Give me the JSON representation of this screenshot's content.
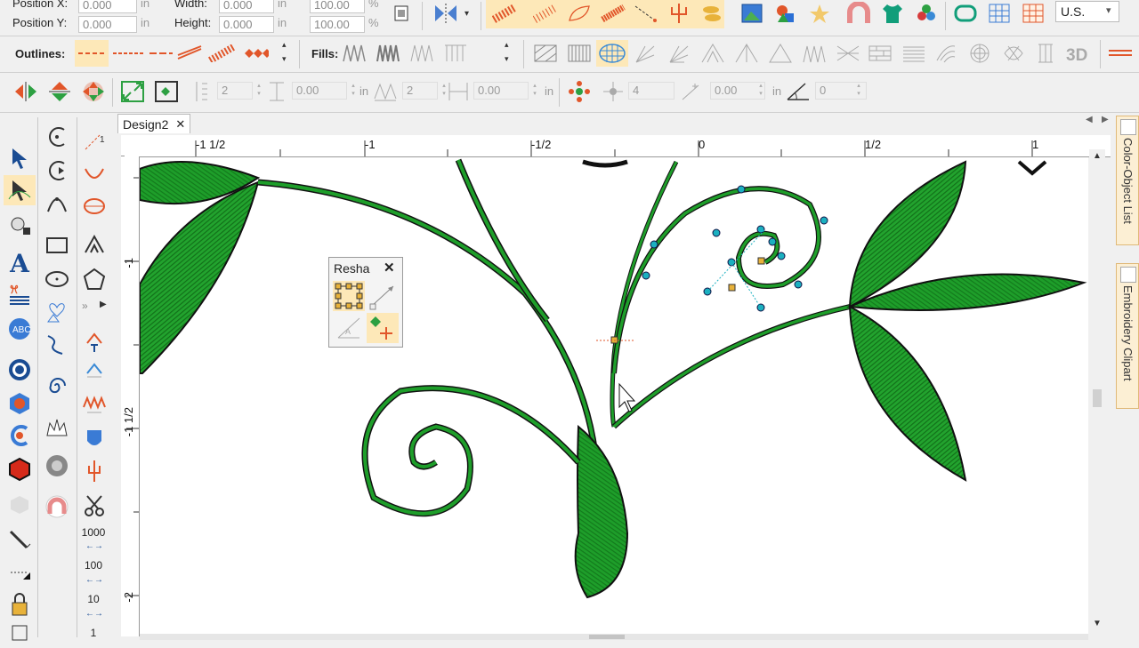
{
  "window": {
    "tab_title": "Design2",
    "tab_close": "✕"
  },
  "position": {
    "x_label": "Position X:",
    "x_value": "0.000",
    "x_unit": "in",
    "y_label": "Position Y:",
    "y_value": "0.000",
    "y_unit": "in",
    "width_label": "Width:",
    "width_value": "0.000",
    "width_unit": "in",
    "height_label": "Height:",
    "height_value": "0.000",
    "height_unit": "in",
    "scale_w": "100.00",
    "scale_h": "100.00",
    "pct": "%"
  },
  "units_select": {
    "value": "U.S."
  },
  "outlines": {
    "label": "Outlines:"
  },
  "fills": {
    "label": "Fills:",
    "threed": "3D"
  },
  "transform_bar": {
    "field1": "2",
    "field2": "0.00",
    "in1": "in",
    "field3": "2",
    "field4": "0.00",
    "in2": "in",
    "field5": "4",
    "field6": "0.00",
    "in3": "in",
    "field7": "0"
  },
  "ruler_h": {
    "m1_5": "-1 1/2",
    "m1": "-1",
    "m05": "-1/2",
    "zero": "0",
    "p05": "1/2",
    "p1": "1"
  },
  "ruler_v": {
    "m1": "-1",
    "m1_5": "-1 1/2",
    "m2": "-2"
  },
  "left_tools": {
    "n1000": "1000",
    "n100": "100",
    "n10": "10",
    "n1": "1"
  },
  "reshape_popup": {
    "title": "Resha",
    "close": "✕"
  },
  "side_panels": {
    "color_object_list": "Color-Object List",
    "embroidery_clipart": "Embroidery Clipart"
  },
  "colors": {
    "accent": "#e1562a",
    "stitch_green": "#1e9e2a",
    "highlight": "#fde8b8"
  }
}
